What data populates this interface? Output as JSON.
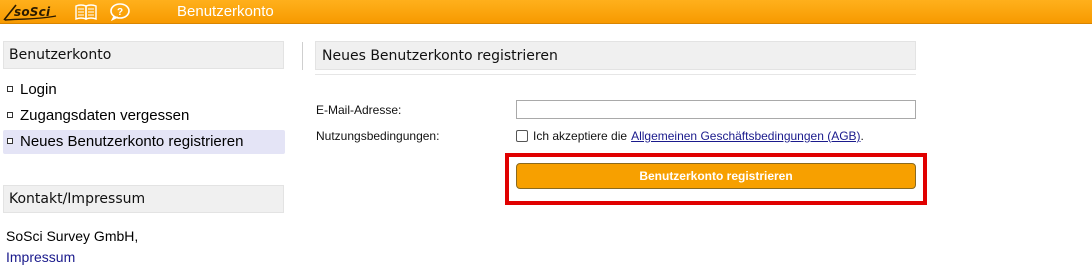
{
  "header": {
    "logo_text": "soSci",
    "app_title": "Benutzerkonto",
    "icons": [
      "book-icon",
      "chat-icon"
    ],
    "bar_color": "#f79a00"
  },
  "sidebar": {
    "section_title": "Benutzerkonto",
    "items": [
      {
        "label": "Login",
        "active": false
      },
      {
        "label": "Zugangsdaten vergessen",
        "active": false
      },
      {
        "label": "Neues Benutzerkonto registrieren",
        "active": true
      }
    ],
    "contact_title": "Kontakt/Impressum",
    "company": "SoSci Survey GmbH,",
    "impressum_link": "Impressum"
  },
  "main": {
    "title": "Neues Benutzerkonto registrieren",
    "email_label": "E-Mail-Adresse:",
    "email_value": "",
    "terms_label": "Nutzungsbedingungen:",
    "terms_text": "Ich akzeptiere die",
    "terms_link": "Allgemeinen Geschäftsbedingungen (AGB)",
    "terms_suffix": ".",
    "terms_checked": false,
    "submit_label": "Benutzerkonto registrieren",
    "button_color": "#f7a000",
    "highlight_color": "#e00000"
  }
}
